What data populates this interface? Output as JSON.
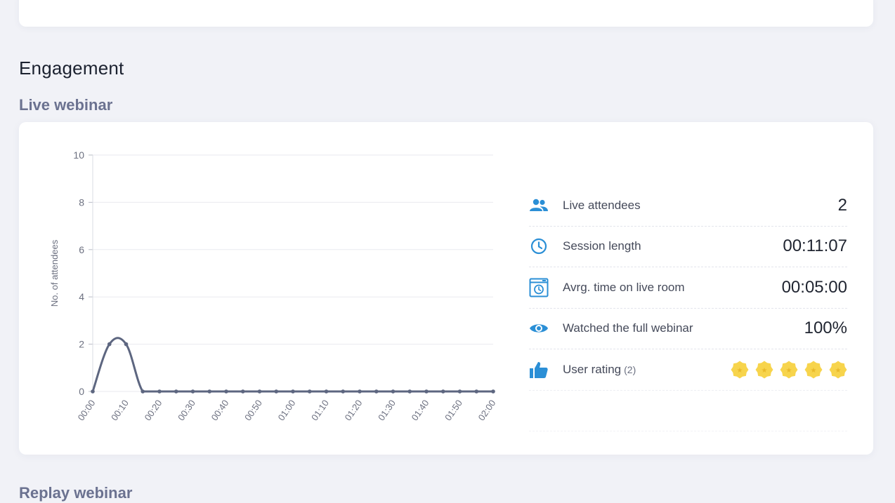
{
  "section": {
    "title": "Engagement"
  },
  "live": {
    "subtitle": "Live webinar"
  },
  "replay": {
    "subtitle": "Replay webinar"
  },
  "stats": [
    {
      "icon": "users-icon",
      "label": "Live attendees",
      "value": "2"
    },
    {
      "icon": "clock-icon",
      "label": "Session length",
      "value": "00:11:07"
    },
    {
      "icon": "live-room-timer-icon",
      "label": "Avrg. time on live room",
      "value": "00:05:00"
    },
    {
      "icon": "eye-icon",
      "label": "Watched the full webinar",
      "value": "100%"
    },
    {
      "icon": "thumbs-up-icon",
      "label": "User rating",
      "count": "(2)",
      "rating": 5,
      "max_rating": 5
    }
  ],
  "colors": {
    "accent": "#2b8fd6",
    "line": "#5d6680",
    "star": "#f7d44c",
    "star_dark": "#e8b92a"
  },
  "chart_data": {
    "type": "line",
    "title": "",
    "xlabel": "",
    "ylabel": "No. of attendees",
    "ylim": [
      0,
      10
    ],
    "yticks": [
      0,
      2,
      4,
      6,
      8,
      10
    ],
    "grid": true,
    "categories": [
      "00:00",
      "00:05",
      "00:10",
      "00:15",
      "00:20",
      "00:25",
      "00:30",
      "00:35",
      "00:40",
      "00:45",
      "00:50",
      "00:55",
      "01:00",
      "01:05",
      "01:10",
      "01:15",
      "01:20",
      "01:25",
      "01:30",
      "01:35",
      "01:40",
      "01:45",
      "01:50",
      "01:55",
      "02:00"
    ],
    "tick_labels": [
      "00:00",
      "00:10",
      "00:20",
      "00:30",
      "00:40",
      "00:50",
      "01:00",
      "01:10",
      "01:20",
      "01:30",
      "01:40",
      "01:50",
      "02:00"
    ],
    "series": [
      {
        "values": [
          0,
          2,
          2,
          0,
          0,
          0,
          0,
          0,
          0,
          0,
          0,
          0,
          0,
          0,
          0,
          0,
          0,
          0,
          0,
          0,
          0,
          0,
          0,
          0,
          0
        ]
      }
    ]
  }
}
